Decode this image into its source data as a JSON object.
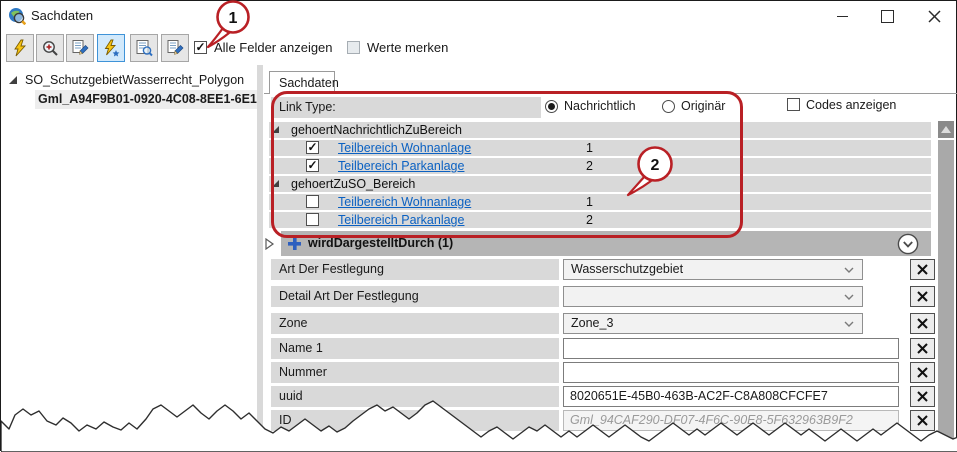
{
  "window": {
    "title": "Sachdaten"
  },
  "toolbar": {
    "buttons": [
      {
        "name": "identify-lightning"
      },
      {
        "name": "zoom-in"
      },
      {
        "name": "form-edit"
      },
      {
        "name": "lightning-new",
        "active": true
      },
      {
        "name": "form-preview"
      },
      {
        "name": "form-edit-copy"
      }
    ],
    "show_all_fields": {
      "label": "Alle Felder anzeigen",
      "checked": true
    },
    "remember_values": {
      "label": "Werte merken",
      "checked": false
    }
  },
  "object_tree": {
    "root_label": "SO_SchutzgebietWasserrecht_Polygon",
    "selected_label": "Gml_A94F9B01-0920-4C08-8EE1-6E1"
  },
  "tabs": {
    "sachdaten": "Sachdaten"
  },
  "link_type": {
    "label": "Link Type:",
    "options": [
      {
        "label": "Nachrichtlich",
        "selected": true
      },
      {
        "label": "Originär",
        "selected": false
      }
    ]
  },
  "codes": {
    "label": "Codes anzeigen",
    "checked": false
  },
  "relations": [
    {
      "group": "gehoertNachrichtlichZuBereich",
      "items": [
        {
          "label": "Teilbereich Wohnanlage",
          "value": "1",
          "checked": true
        },
        {
          "label": "Teilbereich Parkanlage",
          "value": "2",
          "checked": true
        }
      ]
    },
    {
      "group": "gehoertZuSO_Bereich",
      "items": [
        {
          "label": "Teilbereich Wohnanlage",
          "value": "1",
          "checked": false
        },
        {
          "label": "Teilbereich Parkanlage",
          "value": "2",
          "checked": false
        }
      ]
    }
  ],
  "section": {
    "title": "wirdDargestelltDurch (1)"
  },
  "fields": [
    {
      "label": "Art Der Festlegung",
      "type": "combo",
      "value": "Wasserschutzgebiet"
    },
    {
      "label": "Detail Art Der Festlegung",
      "type": "combo",
      "value": ""
    },
    {
      "label": "Zone",
      "type": "combo",
      "value": "Zone_3"
    },
    {
      "label": "Name 1",
      "type": "text",
      "value": ""
    },
    {
      "label": "Nummer",
      "type": "text",
      "value": ""
    },
    {
      "label": "uuid",
      "type": "text",
      "value": "8020651E-45B0-463B-AC2F-C8A808CFCFE7"
    },
    {
      "label": "ID",
      "type": "readonly",
      "value": "Gml_94CAF290-DF07-4F6C-90E8-5F632963B9F2"
    }
  ],
  "callouts": [
    {
      "number": "1"
    },
    {
      "number": "2"
    }
  ],
  "colors": {
    "callout_red": "#b92025",
    "link_blue": "#0b61c2",
    "row_gray": "#d9d9d9",
    "section_gray": "#b5b5b5",
    "active_button_blue": "#d2e9fb"
  }
}
